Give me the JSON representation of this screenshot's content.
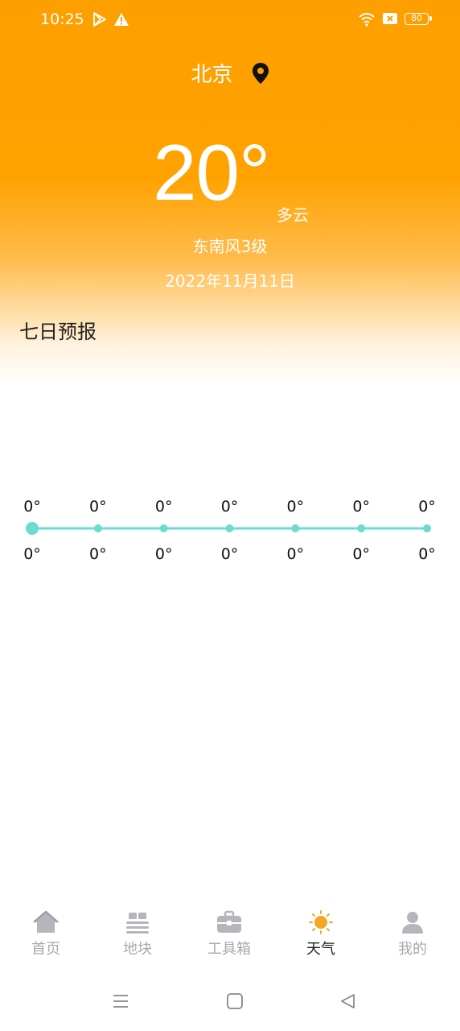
{
  "status_bar": {
    "time": "10:25",
    "battery": "80"
  },
  "location": {
    "city": "北京"
  },
  "weather": {
    "temperature": "20°",
    "condition": "多云",
    "wind": "东南风3级",
    "date": "2022年11月11日"
  },
  "forecast": {
    "title": "七日预报"
  },
  "chart_data": {
    "type": "line",
    "x": [
      1,
      2,
      3,
      4,
      5,
      6,
      7
    ],
    "series": [
      {
        "values": [
          0,
          0,
          0,
          0,
          0,
          0,
          0
        ]
      },
      {
        "values": [
          0,
          0,
          0,
          0,
          0,
          0,
          0
        ]
      }
    ],
    "top_labels": [
      "0°",
      "0°",
      "0°",
      "0°",
      "0°",
      "0°",
      "0°"
    ],
    "bottom_labels": [
      "0°",
      "0°",
      "0°",
      "0°",
      "0°",
      "0°",
      "0°"
    ],
    "line_color": "#6bdccf",
    "grid": false
  },
  "tabs": [
    {
      "label": "首页",
      "icon": "home-icon"
    },
    {
      "label": "地块",
      "icon": "field-icon"
    },
    {
      "label": "工具箱",
      "icon": "toolbox-icon"
    },
    {
      "label": "天气",
      "icon": "sun-icon",
      "active": true
    },
    {
      "label": "我的",
      "icon": "user-icon"
    }
  ],
  "colors": {
    "accent": "#fe9f00",
    "tab_inactive": "#a7a9ae",
    "sun": "#f5a623"
  }
}
